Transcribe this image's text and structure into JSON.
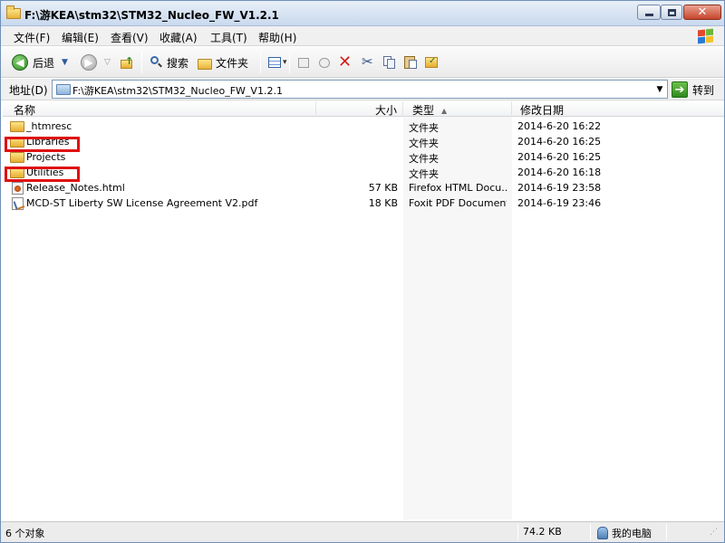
{
  "window": {
    "title": "F:\\游KEA\\stm32\\STM32_Nucleo_FW_V1.2.1"
  },
  "menu": [
    "文件(F)",
    "编辑(E)",
    "查看(V)",
    "收藏(A)",
    "工具(T)",
    "帮助(H)"
  ],
  "toolbar": {
    "back_label": "后退",
    "search_label": "搜索",
    "folders_label": "文件夹"
  },
  "address": {
    "label": "地址(D)",
    "path": "F:\\游KEA\\stm32\\STM32_Nucleo_FW_V1.2.1",
    "go_label": "转到"
  },
  "columns": {
    "name": "名称",
    "size": "大小",
    "type": "类型",
    "modified": "修改日期"
  },
  "files": [
    {
      "name": "_htmresc",
      "size": "",
      "type": "文件夹",
      "modified": "2014-6-20 16:22",
      "icon": "folder"
    },
    {
      "name": "Libraries",
      "size": "",
      "type": "文件夹",
      "modified": "2014-6-20 16:25",
      "icon": "folder"
    },
    {
      "name": "Projects",
      "size": "",
      "type": "文件夹",
      "modified": "2014-6-20 16:25",
      "icon": "folder"
    },
    {
      "name": "Utilities",
      "size": "",
      "type": "文件夹",
      "modified": "2014-6-20 16:18",
      "icon": "folder"
    },
    {
      "name": "Release_Notes.html",
      "size": "57 KB",
      "type": "Firefox HTML Docu...",
      "modified": "2014-6-19 23:58",
      "icon": "html-file"
    },
    {
      "name": "MCD-ST Liberty SW License Agreement V2.pdf",
      "size": "18 KB",
      "type": "Foxit PDF Document",
      "modified": "2014-6-19 23:46",
      "icon": "pdf-file"
    }
  ],
  "status": {
    "count": "6 个对象",
    "size": "74.2 KB",
    "location": "我的电脑"
  },
  "colors": {
    "highlight": "#e01010",
    "title_gradient_top": "#e8eff8",
    "title_gradient_bottom": "#c9d9ee"
  }
}
